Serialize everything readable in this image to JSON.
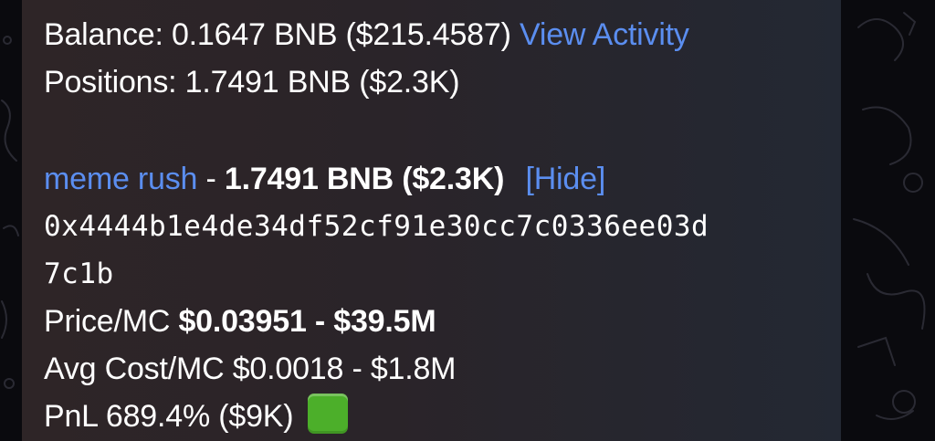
{
  "message": {
    "balance_prefix": "Balance: 0.1647 BNB ($215.4587)",
    "view_activity": "View Activity",
    "positions": "Positions: 1.7491 BNB ($2.3K)",
    "token_name": "meme rush",
    "token_dash": " - ",
    "token_value": "1.7491 BNB ($2.3K)",
    "hide_link": "[Hide]",
    "address_line1": "0x4444b1e4de34df52cf91e30cc7c0336ee03d",
    "address_line2": "7c1b",
    "price_label": "Price/MC ",
    "price_value": "$0.03951 - $39.5M",
    "avg_cost": "Avg Cost/MC $0.0018 - $1.8M",
    "pnl_label": "PnL ",
    "pnl_percent": "689.4%",
    "pnl_amount": " ($9K) ",
    "pnl_indicator_icon": "green-square-icon"
  }
}
